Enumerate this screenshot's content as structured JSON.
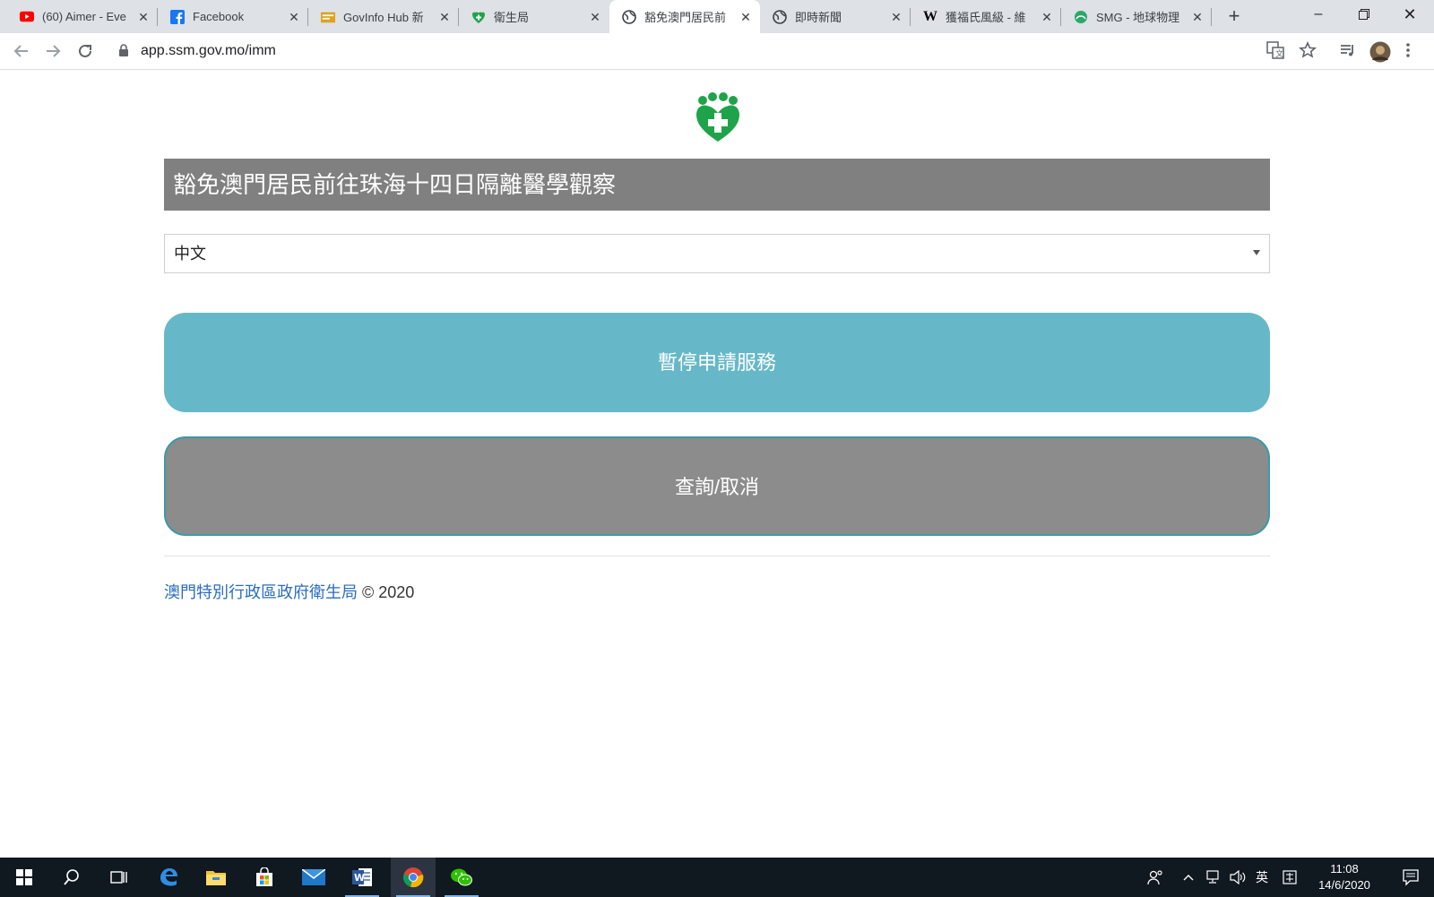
{
  "browser": {
    "tabs": [
      {
        "title": "(60) Aimer - Eve",
        "favicon": "youtube-icon"
      },
      {
        "title": "Facebook",
        "favicon": "facebook-icon"
      },
      {
        "title": "GovInfo Hub 新",
        "favicon": "govinfo-icon"
      },
      {
        "title": "衛生局",
        "favicon": "ssm-shield-icon"
      },
      {
        "title": "豁免澳門居民前",
        "favicon": "globe-icon",
        "active": true
      },
      {
        "title": "即時新聞",
        "favicon": "globe-icon"
      },
      {
        "title": "獲福氏風級 - 維",
        "favicon": "wikipedia-icon"
      },
      {
        "title": "SMG - 地球物理",
        "favicon": "smg-icon"
      }
    ],
    "url": "app.ssm.gov.mo/imm"
  },
  "page": {
    "title": "豁免澳門居民前往珠海十四日隔離醫學觀察",
    "language_selected": "中文",
    "apply_button": "暫停申請服務",
    "query_button": "查詢/取消",
    "footer_link": "澳門特別行政區政府衛生局",
    "footer_copyright": "© 2020"
  },
  "taskbar": {
    "ime": "英",
    "time": "11:08",
    "date": "14/6/2020"
  },
  "colors": {
    "title_bar": "#808080",
    "apply_button": "#66b8c8",
    "query_button": "#8c8c8c",
    "logo_green": "#1fa34a",
    "footer_link": "#2a6dbf"
  }
}
